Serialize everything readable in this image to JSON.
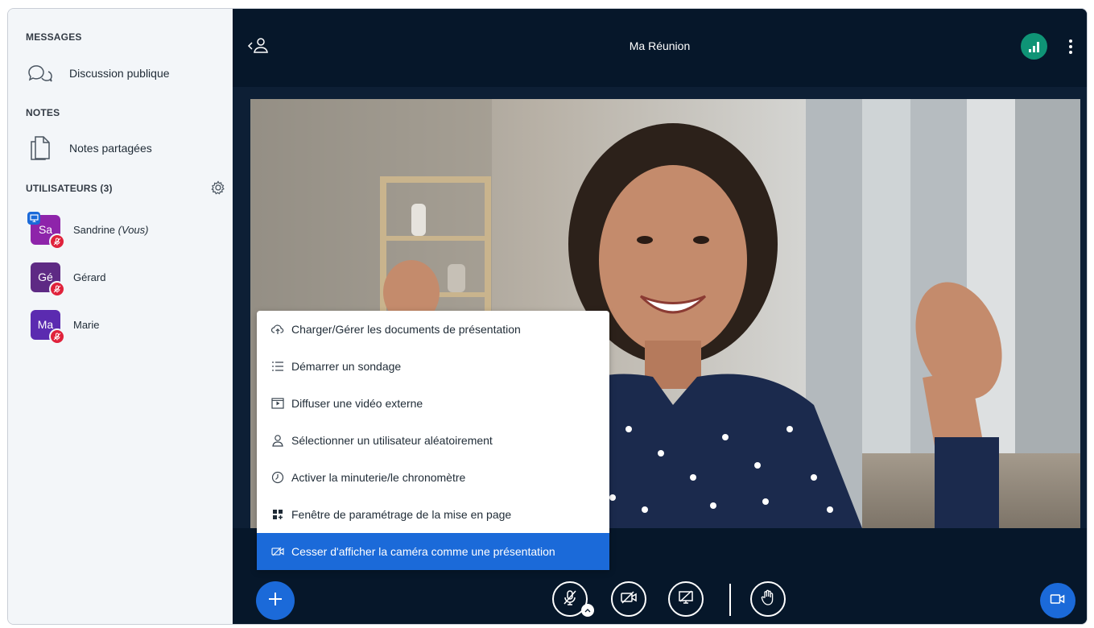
{
  "sidebar": {
    "messages_title": "MESSAGES",
    "public_chat": "Discussion publique",
    "notes_title": "NOTES",
    "shared_notes": "Notes partagées",
    "users_title": "UTILISATEURS (3)",
    "users": [
      {
        "initials": "Sa",
        "name": "Sandrine",
        "suffix": "(Vous)",
        "color": "#8e24aa"
      },
      {
        "initials": "Gé",
        "name": "Gérard",
        "suffix": "",
        "color": "#5e2a84"
      },
      {
        "initials": "Ma",
        "name": "Marie",
        "suffix": "",
        "color": "#5b2bb0"
      }
    ]
  },
  "header": {
    "title": "Ma Réunion"
  },
  "menu": {
    "items": [
      {
        "label": "Charger/Gérer les documents de présentation",
        "icon": "cloud-upload-icon"
      },
      {
        "label": "Démarrer un sondage",
        "icon": "poll-list-icon"
      },
      {
        "label": "Diffuser une vidéo externe",
        "icon": "external-video-icon"
      },
      {
        "label": "Sélectionner un utilisateur aléatoirement",
        "icon": "user-icon"
      },
      {
        "label": "Activer la minuterie/le chronomètre",
        "icon": "timer-icon"
      },
      {
        "label": "Fenêtre de paramétrage de la mise en page",
        "icon": "layout-icon"
      },
      {
        "label": "Cesser d'afficher la caméra comme une présentation",
        "icon": "camera-off-icon"
      }
    ]
  },
  "colors": {
    "accent": "#1b6ad9",
    "background": "#06172a",
    "connection": "#0f9476",
    "muted": "#e0223b"
  }
}
